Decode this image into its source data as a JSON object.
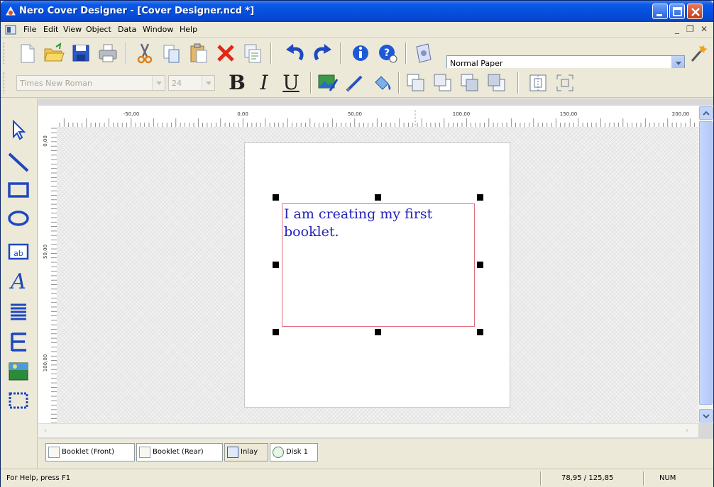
{
  "window": {
    "title": "Nero Cover Designer - [Cover Designer.ncd *]"
  },
  "menu": {
    "items": [
      "File",
      "Edit",
      "View",
      "Object",
      "Data",
      "Window",
      "Help"
    ]
  },
  "toolbar": {
    "paper_select": "Normal Paper",
    "font_select": "Times New Roman",
    "size_select": "24",
    "bold": "B",
    "italic": "I",
    "underline": "U"
  },
  "ruler": {
    "h_ticks": [
      "-50,00",
      "0,00",
      "50,00",
      "100,00",
      "150,00",
      "200,00"
    ],
    "v_ticks": [
      "0,00",
      "50,00",
      "100,00"
    ]
  },
  "document": {
    "text": "I am creating my first booklet."
  },
  "tabs": [
    {
      "label": "Booklet (Front)"
    },
    {
      "label": "Booklet (Rear)"
    },
    {
      "label": "Inlay"
    },
    {
      "label": "Disk 1"
    }
  ],
  "status": {
    "help": "For Help, press F1",
    "coords": "78,95 / 125,85",
    "num": "NUM"
  },
  "colors": {
    "title_bar": "#0550de",
    "text_color": "#2222bb",
    "selection_border": "#e07080"
  }
}
